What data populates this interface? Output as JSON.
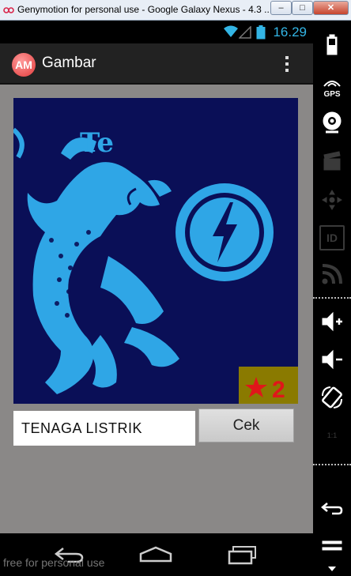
{
  "window": {
    "title": "Genymotion for personal use - Google Galaxy Nexus - 4.3 ...",
    "minimize": "–",
    "maximize": "□",
    "close": "✕"
  },
  "statusbar": {
    "time": "16.29"
  },
  "actionbar": {
    "logo": "AM",
    "title": "Gambar"
  },
  "puzzle": {
    "image_text": "Te",
    "badge_number": "2",
    "colors": {
      "background": "#0a0f57",
      "figure": "#2fa6e6",
      "badge": "#8a7a00",
      "badge_star": "#e0161a"
    }
  },
  "answer": {
    "value": "TENAGA LISTRIK"
  },
  "cek_label": "Cek",
  "watermark": "free for personal use",
  "sidebar": {
    "items": [
      "battery-icon",
      "gps-icon",
      "webcam-icon",
      "video-icon",
      "dpad-icon",
      "id-icon",
      "rss-icon",
      "volume-up-icon",
      "volume-down-icon",
      "rotate-icon",
      "scale-icon",
      "back-icon",
      "menu-icon",
      "home-icon"
    ],
    "gps_label": "GPS",
    "id_label": "ID",
    "scale_label": "1:1"
  }
}
